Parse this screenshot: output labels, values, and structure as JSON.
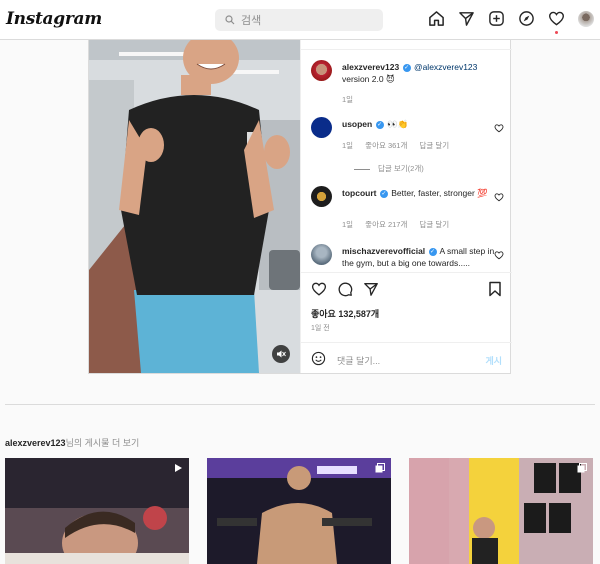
{
  "app": {
    "logo": "Instagram"
  },
  "search": {
    "placeholder": "검색"
  },
  "nav": {
    "icons": [
      "home-icon",
      "direct-icon",
      "new-post-icon",
      "explore-icon",
      "activity-icon",
      "profile-avatar"
    ]
  },
  "post": {
    "caption": {
      "username": "alexzverev123",
      "mention": "@alexzverev123",
      "text": "version 2.0 😈",
      "time": "1일"
    },
    "comments": [
      {
        "username": "usopen",
        "text": "👀👏",
        "time": "1일",
        "likes": "좋아요 361개",
        "reply": "답글 달기",
        "view_replies": "답글 보기(2개)"
      },
      {
        "username": "topcourt",
        "text": "Better, faster, stronger 💯",
        "time": "1일",
        "likes": "좋아요 217개",
        "reply": "답글 달기"
      },
      {
        "username": "mischazverevofficial",
        "text": "A small step in the gym, but a big one towards....."
      }
    ],
    "likes": "좋아요 132,587개",
    "posted_ago": "1일 전",
    "add_comment_placeholder": "댓글 달기...",
    "post_button": "게시"
  },
  "more_posts": {
    "username": "alexzverev123",
    "suffix": "님의 게시물 더 보기"
  },
  "colors": {
    "accent": "#3897f0",
    "notification": "#ed4956",
    "post_btn_disabled": "#b2dffc"
  }
}
